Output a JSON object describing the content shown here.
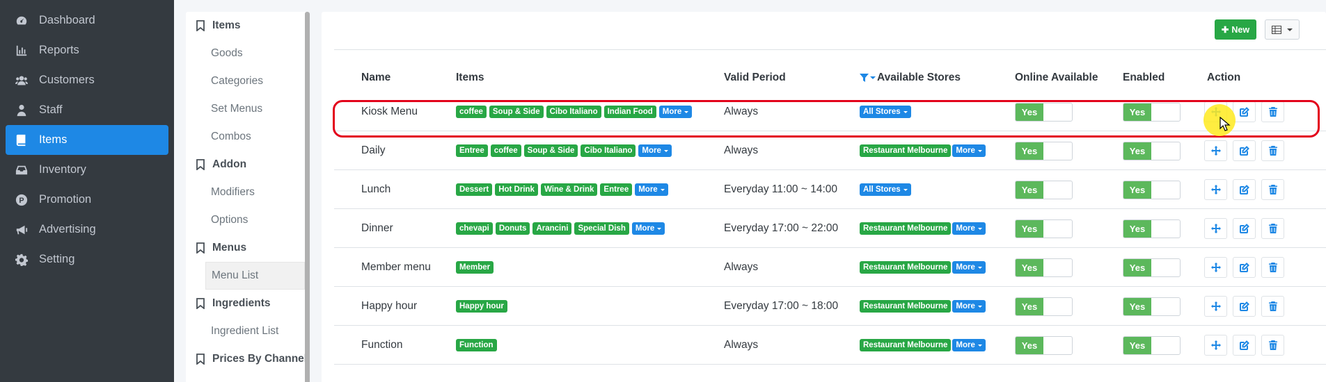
{
  "sidebar": {
    "items": [
      {
        "label": "Dashboard",
        "icon": "dashboard-icon"
      },
      {
        "label": "Reports",
        "icon": "bar-chart-icon"
      },
      {
        "label": "Customers",
        "icon": "users-icon"
      },
      {
        "label": "Staff",
        "icon": "staff-icon"
      },
      {
        "label": "Items",
        "icon": "book-icon",
        "active": true
      },
      {
        "label": "Inventory",
        "icon": "inbox-icon"
      },
      {
        "label": "Promotion",
        "icon": "promotion-icon"
      },
      {
        "label": "Advertising",
        "icon": "megaphone-icon"
      },
      {
        "label": "Setting",
        "icon": "gear-icon"
      }
    ]
  },
  "subnav": {
    "items_header": "Items",
    "goods": "Goods",
    "categories": "Categories",
    "set_menus": "Set Menus",
    "combos": "Combos",
    "addon_header": "Addon",
    "modifiers": "Modifiers",
    "options": "Options",
    "menus_header": "Menus",
    "menu_list": "Menu List",
    "ingredients_header": "Ingredients",
    "ingredient_list": "Ingredient List",
    "prices_header": "Prices By Channel"
  },
  "toolbar": {
    "new_label": "New"
  },
  "table": {
    "headers": {
      "name": "Name",
      "items": "Items",
      "valid_period": "Valid Period",
      "stores": "Available Stores",
      "online": "Online Available",
      "enabled": "Enabled",
      "action": "Action"
    },
    "more_label": "More",
    "yes_label": "Yes",
    "rows": [
      {
        "name": "Kiosk Menu",
        "items": [
          "coffee",
          "Soup & Side",
          "Cibo Italiano",
          "Indian Food"
        ],
        "more": true,
        "period": "Always",
        "store": "All Stores",
        "store_more": false
      },
      {
        "name": "Daily",
        "items": [
          "Entree",
          "coffee",
          "Soup & Side",
          "Cibo Italiano"
        ],
        "more": true,
        "period": "Always",
        "store": "Restaurant Melbourne",
        "store_more": true
      },
      {
        "name": "Lunch",
        "items": [
          "Dessert",
          "Hot Drink",
          "Wine & Drink",
          "Entree"
        ],
        "more": true,
        "period": "Everyday 11:00 ~ 14:00",
        "store": "All Stores",
        "store_more": false
      },
      {
        "name": "Dinner",
        "items": [
          "chevapi",
          "Donuts",
          "Arancini",
          "Special Dish"
        ],
        "more": true,
        "period": "Everyday 17:00 ~ 22:00",
        "store": "Restaurant Melbourne",
        "store_more": true
      },
      {
        "name": "Member menu",
        "items": [
          "Member"
        ],
        "more": false,
        "period": "Always",
        "store": "Restaurant Melbourne",
        "store_more": true
      },
      {
        "name": "Happy hour",
        "items": [
          "Happy hour"
        ],
        "more": false,
        "period": "Everyday 17:00 ~ 18:00",
        "store": "Restaurant Melbourne",
        "store_more": true
      },
      {
        "name": "Function",
        "items": [
          "Function"
        ],
        "more": false,
        "period": "Always",
        "store": "Restaurant Melbourne",
        "store_more": true
      }
    ]
  },
  "colors": {
    "accent": "#1e88e5",
    "success": "#28a745",
    "sidebar": "#343a40",
    "highlight": "#e3001b"
  }
}
